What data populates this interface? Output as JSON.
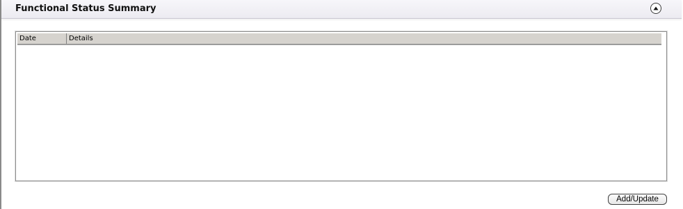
{
  "panel": {
    "title": "Functional Status Summary",
    "collapse_icon": "chevron-up-circle-icon"
  },
  "grid": {
    "columns": [
      "Date",
      "Details"
    ],
    "rows": []
  },
  "actions": {
    "add_update_label": "Add/Update"
  }
}
